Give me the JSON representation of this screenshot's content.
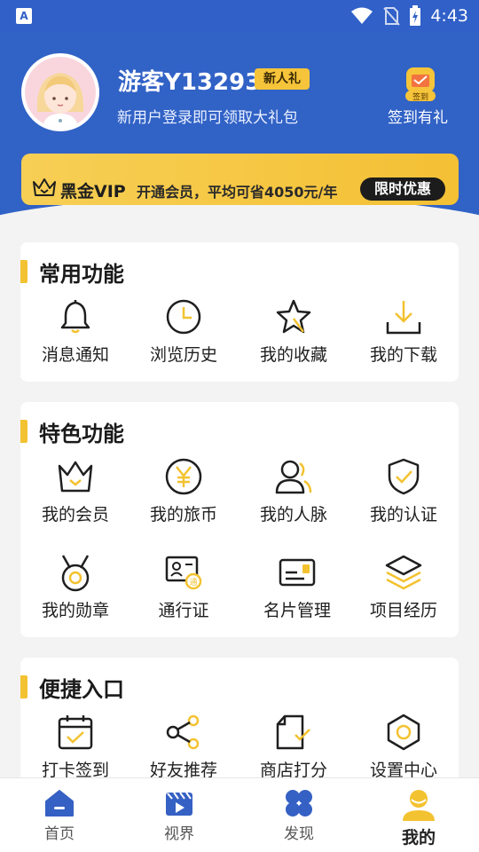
{
  "status_bar": {
    "time": "4:43",
    "left_icon_label": "A"
  },
  "profile": {
    "username": "游客Y13293",
    "badge": "新人礼",
    "subtitle": "新用户登录即可领取大礼包",
    "signin_icon_label": "签到",
    "signin_label": "签到有礼"
  },
  "vip": {
    "title": "黑金VIP",
    "description": "开通会员，平均可省4050元/年",
    "button": "限时优惠"
  },
  "sections": [
    {
      "title": "常用功能",
      "items": [
        {
          "label": "消息通知",
          "icon": "bell-icon"
        },
        {
          "label": "浏览历史",
          "icon": "clock-icon"
        },
        {
          "label": "我的收藏",
          "icon": "star-icon"
        },
        {
          "label": "我的下载",
          "icon": "download-icon"
        }
      ]
    },
    {
      "title": "特色功能",
      "items": [
        {
          "label": "我的会员",
          "icon": "crown-icon"
        },
        {
          "label": "我的旅币",
          "icon": "yen-coin-icon"
        },
        {
          "label": "我的人脉",
          "icon": "contacts-icon"
        },
        {
          "label": "我的认证",
          "icon": "shield-check-icon"
        },
        {
          "label": "我的勋章",
          "icon": "medal-icon"
        },
        {
          "label": "通行证",
          "icon": "pass-card-icon",
          "icon_text": "通"
        },
        {
          "label": "名片管理",
          "icon": "business-card-icon"
        },
        {
          "label": "项目经历",
          "icon": "layers-icon"
        }
      ]
    },
    {
      "title": "便捷入口",
      "items": [
        {
          "label": "打卡签到",
          "icon": "calendar-check-icon"
        },
        {
          "label": "好友推荐",
          "icon": "share-icon"
        },
        {
          "label": "商店打分",
          "icon": "file-check-icon"
        },
        {
          "label": "设置中心",
          "icon": "settings-hexagon-icon"
        }
      ]
    }
  ],
  "tabbar": [
    {
      "label": "首页",
      "icon": "home-icon",
      "active": false
    },
    {
      "label": "视界",
      "icon": "video-icon",
      "active": false
    },
    {
      "label": "发现",
      "icon": "discover-icon",
      "active": false
    },
    {
      "label": "我的",
      "icon": "profile-icon",
      "active": true
    }
  ],
  "colors": {
    "primary_blue": "#3162c6",
    "accent_yellow": "#f3c230",
    "background": "#f3f3f3"
  }
}
